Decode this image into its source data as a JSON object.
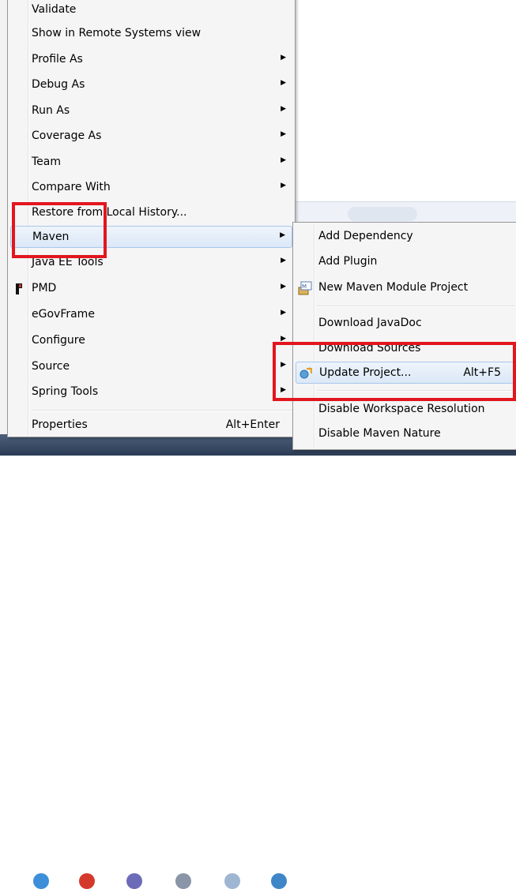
{
  "context_menu": {
    "items": [
      {
        "label": "Validate",
        "arrow": ""
      },
      {
        "label": "Show in Remote Systems view",
        "arrow": ""
      },
      {
        "label": "Profile As",
        "arrow": "▶"
      },
      {
        "label": "Debug As",
        "arrow": "▶"
      },
      {
        "label": "Run As",
        "arrow": "▶"
      },
      {
        "label": "Coverage As",
        "arrow": "▶"
      },
      {
        "label": "Team",
        "arrow": "▶"
      },
      {
        "label": "Compare With",
        "arrow": "▶"
      },
      {
        "label": "Restore from Local History...",
        "arrow": ""
      },
      {
        "label": "Maven",
        "arrow": "▶"
      },
      {
        "label": "Java EE Tools",
        "arrow": "▶"
      },
      {
        "label": "PMD",
        "arrow": "▶"
      },
      {
        "label": "eGovFrame",
        "arrow": "▶"
      },
      {
        "label": "Configure",
        "arrow": "▶"
      },
      {
        "label": "Source",
        "arrow": "▶"
      },
      {
        "label": "Spring Tools",
        "arrow": "▶"
      },
      {
        "label": "Properties",
        "accelerator": "Alt+Enter"
      }
    ]
  },
  "maven_submenu": {
    "items": [
      {
        "label": "Add Dependency"
      },
      {
        "label": "Add Plugin"
      },
      {
        "label": "New Maven Module Project"
      },
      {
        "label": "Download JavaDoc"
      },
      {
        "label": "Download Sources"
      },
      {
        "label": "Update Project...",
        "accelerator": "Alt+F5"
      },
      {
        "label": "Disable Workspace Resolution"
      },
      {
        "label": "Disable Maven Nature"
      }
    ]
  },
  "colors": {
    "highlight_border": "#e2161e",
    "menu_background": "#f5f5f5",
    "hover_background": "#dbe8f7"
  }
}
